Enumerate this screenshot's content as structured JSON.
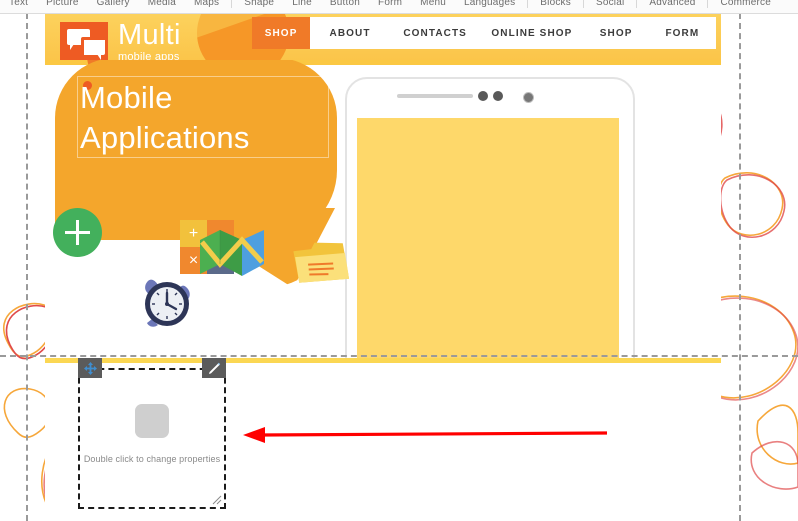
{
  "editor": {
    "toolbar_items": [
      "Text",
      "Picture",
      "Gallery",
      "Media",
      "Maps",
      "Shape",
      "Line",
      "Button",
      "Form",
      "Menu",
      "Languages",
      "Blocks",
      "Social",
      "Advanced",
      "Commerce"
    ]
  },
  "site": {
    "logo": {
      "title": "Multi",
      "subtitle": "mobile apps",
      "mark": "speech-bubbles-icon"
    },
    "nav": [
      {
        "label": "SHOP",
        "active": true
      },
      {
        "label": "ABOUT",
        "active": false
      },
      {
        "label": "CONTACTS",
        "active": false
      },
      {
        "label": "ONLINE SHOP",
        "active": false
      },
      {
        "label": "SHOP",
        "active": false
      },
      {
        "label": "FORM",
        "active": false
      }
    ],
    "hero": {
      "title_line1": "Mobile",
      "title_line2": "Applications",
      "add_button": "+",
      "calculator": {
        "plus": "+",
        "minus": "−",
        "times": "×",
        "equals": "="
      }
    }
  },
  "widget": {
    "hint": "Double click to change properties",
    "move_handle": "move-icon",
    "edit_handle": "pencil-icon",
    "resize_handle": "resize-grip-icon",
    "icon": "placeholder-image-icon"
  },
  "annotation": {
    "arrow": "red-left-arrow",
    "color": "#ff0000"
  },
  "colors": {
    "header_yellow": "#fbc843",
    "brand_orange": "#ee5b23",
    "bubble_orange": "#f4a62c",
    "nav_active": "#f07a28",
    "screen_yellow": "#fed86a",
    "green_accent": "#43b05c",
    "guide_gray": "#9a9a9a"
  }
}
